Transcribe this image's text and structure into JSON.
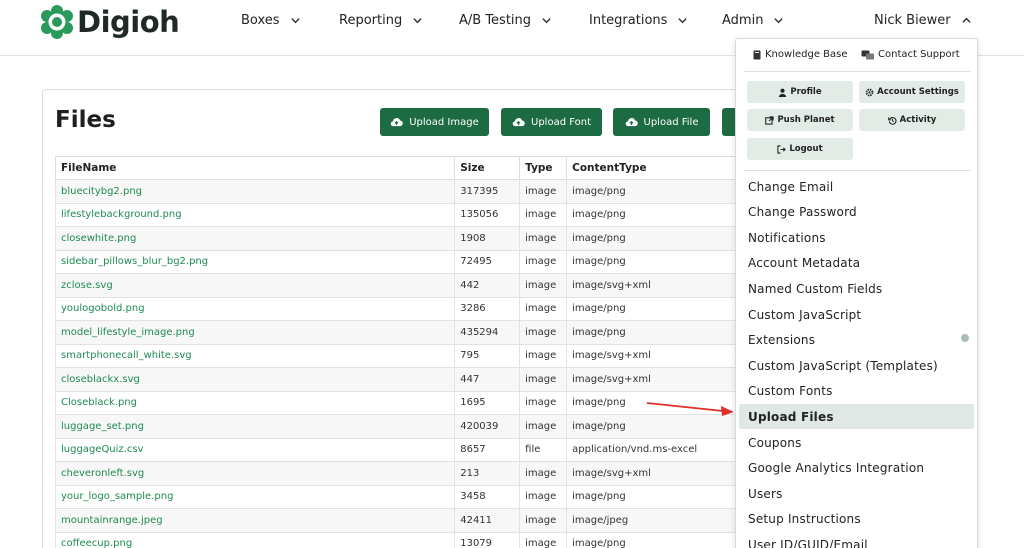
{
  "brand": {
    "name": "Digioh",
    "accent": "#1d6b43",
    "logo_color": "#2a9a5c"
  },
  "nav": {
    "items": [
      {
        "label": "Boxes"
      },
      {
        "label": "Reporting"
      },
      {
        "label": "A/B Testing"
      },
      {
        "label": "Integrations"
      },
      {
        "label": "Admin"
      }
    ],
    "user": "Nick Biewer"
  },
  "files": {
    "title": "Files",
    "buttons": {
      "upload_image": "Upload Image",
      "upload_font": "Upload Font",
      "upload_file": "Upload File"
    },
    "columns": [
      "FileName",
      "Size",
      "Type",
      "ContentType"
    ],
    "rows": [
      [
        "bluecitybg2.png",
        "317395",
        "image",
        "image/png"
      ],
      [
        "lifestylebackground.png",
        "135056",
        "image",
        "image/png"
      ],
      [
        "closewhite.png",
        "1908",
        "image",
        "image/png"
      ],
      [
        "sidebar_pillows_blur_bg2.png",
        "72495",
        "image",
        "image/png"
      ],
      [
        "zclose.svg",
        "442",
        "image",
        "image/svg+xml"
      ],
      [
        "youlogobold.png",
        "3286",
        "image",
        "image/png"
      ],
      [
        "model_lifestyle_image.png",
        "435294",
        "image",
        "image/png"
      ],
      [
        "smartphonecall_white.svg",
        "795",
        "image",
        "image/svg+xml"
      ],
      [
        "closeblackx.svg",
        "447",
        "image",
        "image/svg+xml"
      ],
      [
        "Closeblack.png",
        "1695",
        "image",
        "image/png"
      ],
      [
        "luggage_set.png",
        "420039",
        "image",
        "image/png"
      ],
      [
        "luggageQuiz.csv",
        "8657",
        "file",
        "application/vnd.ms-excel"
      ],
      [
        "cheveronleft.svg",
        "213",
        "image",
        "image/svg+xml"
      ],
      [
        "your_logo_sample.png",
        "3458",
        "image",
        "image/png"
      ],
      [
        "mountainrange.jpeg",
        "42411",
        "image",
        "image/jpeg"
      ],
      [
        "coffeecup.png",
        "13079",
        "image",
        "image/png"
      ]
    ]
  },
  "menu": {
    "knowledge_base": "Knowledge Base",
    "contact_support": "Contact Support",
    "buttons": {
      "profile": "Profile",
      "account_settings": "Account Settings",
      "push_planet": "Push Planet",
      "activity": "Activity",
      "logout": "Logout"
    },
    "items": [
      "Change Email",
      "Change Password",
      "Notifications",
      "Account Metadata",
      "Named Custom Fields",
      "Custom JavaScript",
      "Extensions",
      "Custom JavaScript (Templates)",
      "Custom Fonts",
      "Upload Files",
      "Coupons",
      "Google Analytics Integration",
      "Users",
      "Setup Instructions",
      "User ID/GUID/Email"
    ],
    "active_item": "Upload Files"
  },
  "annotation": {
    "arrow_color": "#e0302a"
  }
}
